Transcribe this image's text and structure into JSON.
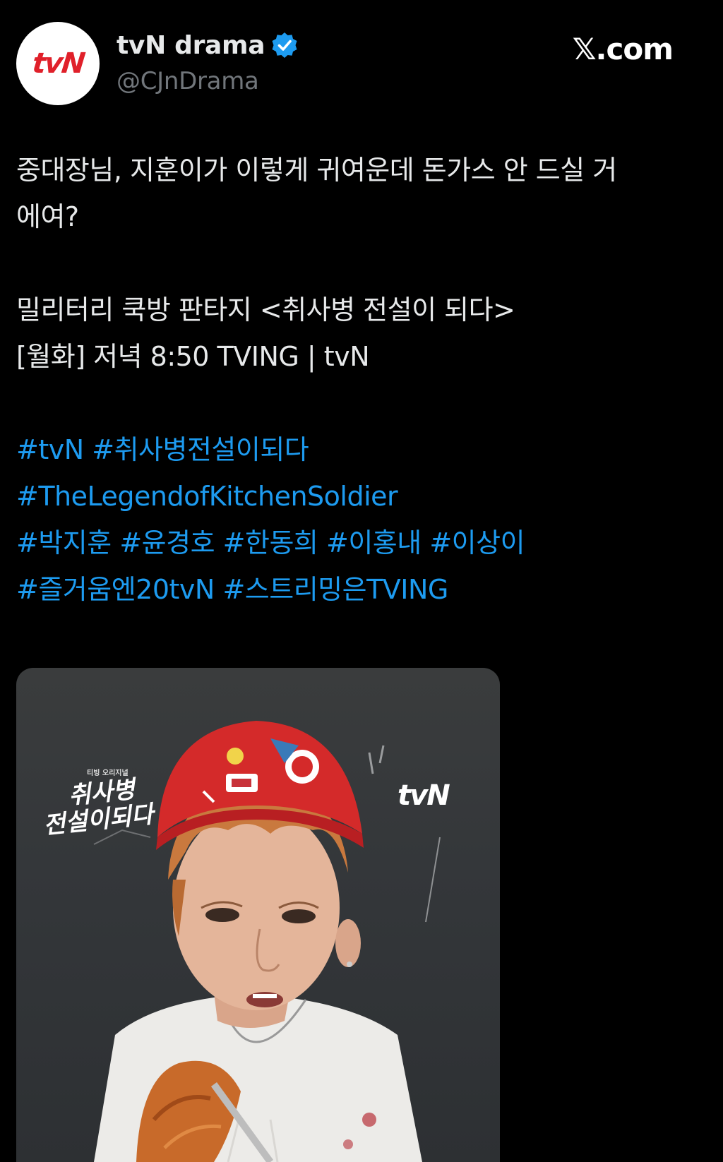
{
  "account": {
    "avatar_logo": "tvN",
    "display_name": "tvN drama",
    "handle": "@CJnDrama",
    "verified": true,
    "verified_icon": "verified-badge-icon",
    "avatar_color": "#e0202a"
  },
  "brand": {
    "site": "𝕏.com"
  },
  "tweet": {
    "line1": "중대장님, 지훈이가 이렇게 귀여운데 돈가스 안 드실 거",
    "line2": "에여?",
    "line3": "밀리터리 쿡방 판타지 <취사병 전설이 되다>",
    "line4": "[월화] 저녁 8:50 TVING | tvN",
    "hashtags": [
      [
        "#tvN",
        "#취사병전설이되다"
      ],
      [
        "#TheLegendofKitchenSoldier"
      ],
      [
        "#박지훈",
        "#윤경호",
        "#한동희",
        "#이홍내",
        "#이상이"
      ],
      [
        "#즐거움엔20tvN",
        "#스트리밍은TVING"
      ]
    ]
  },
  "media": {
    "show_logo_small": "티빙 오리지널",
    "show_logo_line1": "취사병",
    "show_logo_line2": "전설이되다",
    "channel_logo": "tvN"
  },
  "colors": {
    "background": "#000000",
    "text": "#e7e9ea",
    "secondary": "#71767b",
    "link": "#1d9bf0",
    "verified": "#1d9bf0"
  }
}
